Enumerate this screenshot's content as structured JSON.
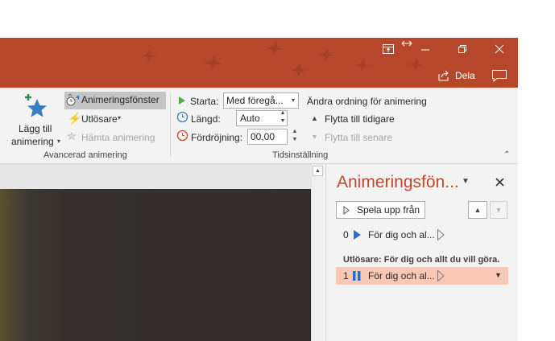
{
  "colors": {
    "accent": "#b7472a",
    "pane_title": "#c0472a",
    "selected_row": "#f9c9b6"
  },
  "titlebar": {
    "share_label": "Dela",
    "icons": [
      "ribbon-display-icon",
      "restore-arrows-icon",
      "minimize-icon",
      "restore-icon",
      "close-icon",
      "share-icon",
      "comment-icon"
    ]
  },
  "ribbon": {
    "advanced": {
      "add_animation_line1": "Lägg till",
      "add_animation_line2": "animering",
      "animation_pane": "Animeringsfönster",
      "trigger": "Utlösare",
      "painter": "Hämta animering",
      "group_label": "Avancerad animering"
    },
    "timing": {
      "start_label": "Starta:",
      "start_value": "Med föregå...",
      "duration_label": "Längd:",
      "duration_value": "Auto",
      "delay_label": "Fördröjning:",
      "delay_value": "00,00",
      "reorder_title": "Ändra ordning för animering",
      "move_earlier": "Flytta till tidigare",
      "move_later": "Flytta till senare",
      "group_label": "Tidsinställning"
    }
  },
  "pane": {
    "title": "Animeringsfön...",
    "play_from": "Spela upp från",
    "items": [
      {
        "number": "0",
        "label": "För dig och al..."
      }
    ],
    "trigger_heading": "Utlösare: För dig och allt du vill göra.",
    "trigger_items": [
      {
        "number": "1",
        "label": "För dig och al..."
      }
    ]
  }
}
